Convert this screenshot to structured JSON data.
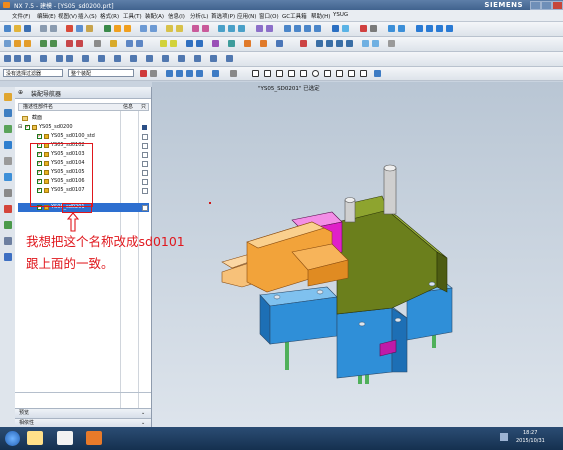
{
  "window": {
    "title": "NX 7.5 - 建模 - [YS05_sd0200.prt]",
    "brand": "SIEMENS"
  },
  "menu": [
    "文件(F)",
    "编辑(E)",
    "视图(V)",
    "插入(S)",
    "格式(R)",
    "工具(T)",
    "装配(A)",
    "信息(I)",
    "分析(L)",
    "首选项(P)",
    "应用(N)",
    "窗口(O)",
    "GC工具箱",
    "帮助(H)",
    "YSUG"
  ],
  "filter": {
    "type_filter": "没有选择过滤器",
    "scope": "整个装配"
  },
  "viewport": {
    "label": "\"YS05_SD0201\" 已选定"
  },
  "navigator": {
    "title": "装配导航器",
    "col_name": "描述性部件名",
    "col_info": "信息",
    "col_ro": "只",
    "rows": [
      {
        "label": "截面",
        "level": 1,
        "kind": "folder"
      },
      {
        "label": "YS05_sd0200",
        "level": 0,
        "kind": "assembly"
      },
      {
        "label": "YS05_sd0100_std",
        "level": 1,
        "kind": "part"
      },
      {
        "label": "YS05_sd0102",
        "level": 1,
        "kind": "part"
      },
      {
        "label": "YS05_sd0103",
        "level": 1,
        "kind": "part"
      },
      {
        "label": "YS05_sd0104",
        "level": 1,
        "kind": "part"
      },
      {
        "label": "YS05_sd0105",
        "level": 1,
        "kind": "part"
      },
      {
        "label": "YS05_sd0106",
        "level": 1,
        "kind": "part"
      },
      {
        "label": "YS05_sd0107",
        "level": 1,
        "kind": "part"
      },
      {
        "label": "YS05_sd0201",
        "level": 1,
        "kind": "part",
        "selected": true
      }
    ],
    "footer1": "预览",
    "footer2": "相依性"
  },
  "annotation": {
    "line1": "我想把这个名称改成sd0101",
    "line2": "跟上面的一致。"
  },
  "taskbar": {
    "time": "18:27",
    "date": "2015/10/31"
  },
  "colors": {
    "accent_red": "#e0171d",
    "selection_blue": "#2d6fd0",
    "steel_blue": "#2f8fd8",
    "olive": "#6b7f1c",
    "magenta": "#e020c8",
    "orange": "#f2a33a"
  }
}
